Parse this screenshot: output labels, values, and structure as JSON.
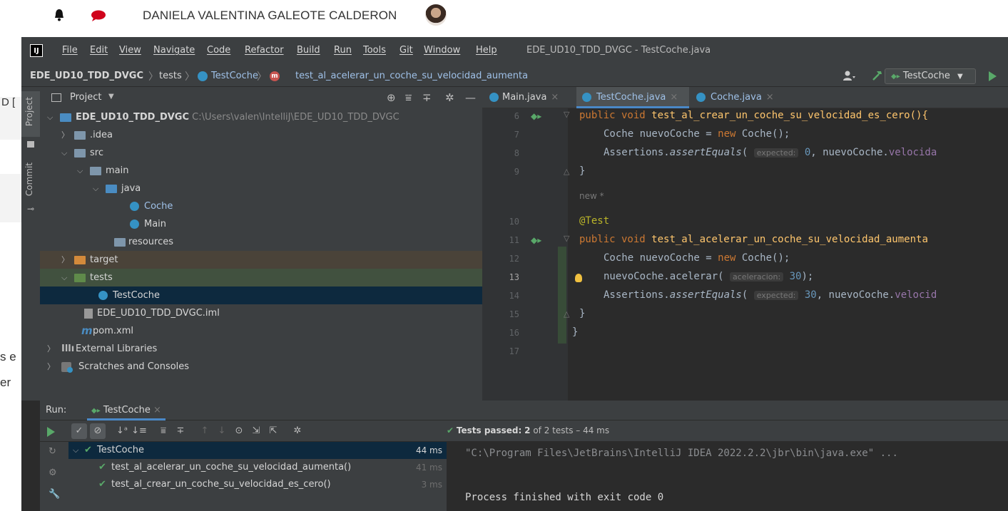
{
  "page": {
    "user_name": "DANIELA VALENTINA GALEOTE CALDERON",
    "fragments": [
      "D [",
      "s e",
      "er"
    ]
  },
  "ide": {
    "logo": "IJ",
    "menu": [
      "File",
      "Edit",
      "View",
      "Navigate",
      "Code",
      "Refactor",
      "Build",
      "Run",
      "Tools",
      "Git",
      "Window",
      "Help"
    ],
    "window_title": "EDE_UD10_TDD_DVGC - TestCoche.java",
    "breadcrumb": {
      "project": "EDE_UD10_TDD_DVGC",
      "folder": "tests",
      "class": "TestCoche",
      "method": "test_al_acelerar_un_coche_su_velocidad_aumenta"
    },
    "run_config": "TestCoche",
    "side_stripe": [
      "Project",
      "Commit"
    ],
    "project_panel": {
      "title": "Project",
      "tree": {
        "root_name": "EDE_UD10_TDD_DVGC",
        "root_path": "C:\\Users\\valen\\IntelliJ\\EDE_UD10_TDD_DVGC",
        "idea": ".idea",
        "src": "src",
        "main": "main",
        "java": "java",
        "coche": "Coche",
        "main_class": "Main",
        "resources": "resources",
        "target": "target",
        "tests": "tests",
        "testcoche": "TestCoche",
        "iml": "EDE_UD10_TDD_DVGC.iml",
        "pom": "pom.xml",
        "ext_libs": "External Libraries",
        "scratches": "Scratches and Consoles"
      }
    },
    "editor": {
      "tabs": [
        {
          "label": "Main.java"
        },
        {
          "label": "TestCoche.java"
        },
        {
          "label": "Coche.java"
        }
      ],
      "line_numbers": [
        "6",
        "7",
        "8",
        "9",
        "10",
        "11",
        "12",
        "13",
        "14",
        "15",
        "16",
        "17"
      ],
      "new_marker": "new *",
      "code": {
        "l6_kw": "public void ",
        "l6_fn": "test_al_crear_un_coche_su_velocidad_es_cero(){",
        "l7_a": "Coche nuevoCoche = ",
        "l7_kw": "new ",
        "l7_b": "Coche();",
        "l8_a": "Assertions.",
        "l8_it": "assertEquals",
        "l8_b": "( ",
        "l8_hint": "expected:",
        "l8_num": " 0",
        "l8_c": ", nuevoCoche.",
        "l8_fld": "velocida",
        "l9": "}",
        "l10": "@Test",
        "l11_kw": "public void ",
        "l11_fn": "test_al_acelerar_un_coche_su_velocidad_aumenta",
        "l12_a": "Coche nuevoCoche = ",
        "l12_kw": "new ",
        "l12_b": "Coche();",
        "l13_a": "nuevoCoche.",
        "l13_fn": "acelerar",
        "l13_b": "( ",
        "l13_hint": "aceleracion:",
        "l13_num": " 30",
        "l13_c": ");",
        "l14_a": "Assertions.",
        "l14_it": "assertEquals",
        "l14_b": "( ",
        "l14_hint": "expected:",
        "l14_num": " 30",
        "l14_c": ", nuevoCoche.",
        "l14_fld": "velocid",
        "l15": "}",
        "l16": "}"
      }
    },
    "run": {
      "label": "Run:",
      "tab": "TestCoche",
      "status": {
        "prefix": "Tests passed:",
        "count": "2",
        "suffix": "of 2 tests – 44 ms"
      },
      "tests": [
        {
          "name": "TestCoche",
          "time": "44 ms"
        },
        {
          "name": "test_al_acelerar_un_coche_su_velocidad_aumenta()",
          "time": "41 ms"
        },
        {
          "name": "test_al_crear_un_coche_su_velocidad_es_cero()",
          "time": "3 ms"
        }
      ],
      "console": {
        "command": "\"C:\\Program Files\\JetBrains\\IntelliJ IDEA 2022.2.2\\jbr\\bin\\java.exe\" ...",
        "result": "Process finished with exit code 0"
      }
    }
  },
  "colors": {
    "accent": "#4a88c7",
    "pass": "#59a869",
    "keyword": "#cc7832",
    "method": "#ffc66d"
  }
}
